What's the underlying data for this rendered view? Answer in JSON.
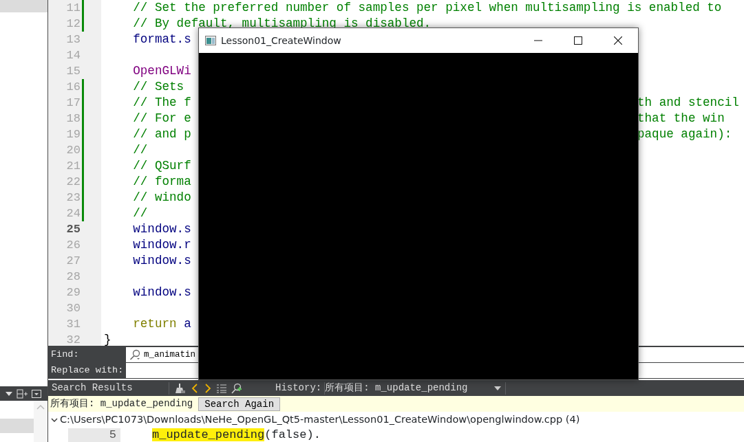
{
  "editor": {
    "lines": [
      {
        "number": "11",
        "modified": true,
        "current": false,
        "segments": [
          {
            "kind": "comment",
            "text": "    // Set the preferred number of samples per pixel when multisampling is enabled to"
          }
        ]
      },
      {
        "number": "12",
        "modified": true,
        "current": false,
        "segments": [
          {
            "kind": "comment",
            "text": "    // By default, multisampling is disabled."
          }
        ]
      },
      {
        "number": "13",
        "modified": false,
        "current": false,
        "segments": [
          {
            "kind": "code",
            "text": "    format.s"
          }
        ]
      },
      {
        "number": "14",
        "modified": false,
        "current": false
      },
      {
        "number": "15",
        "modified": false,
        "current": false,
        "segments": [
          {
            "kind": "type",
            "text": "    OpenGLWi"
          }
        ]
      },
      {
        "number": "16",
        "modified": true,
        "current": false,
        "segments": [
          {
            "kind": "comment",
            "text": "    // Sets"
          }
        ]
      },
      {
        "number": "17",
        "modified": true,
        "current": false,
        "segments": [
          {
            "kind": "comment",
            "text": "    // The f"
          }
        ],
        "after_window": {
          "kind": "comment",
          "text": "th and stencil"
        }
      },
      {
        "number": "18",
        "modified": true,
        "current": false,
        "segments": [
          {
            "kind": "comment",
            "text": "    // For e"
          }
        ],
        "after_window": {
          "kind": "comment",
          "text": "that the win"
        }
      },
      {
        "number": "19",
        "modified": true,
        "current": false,
        "segments": [
          {
            "kind": "comment",
            "text": "    // and p"
          }
        ],
        "after_window": {
          "kind": "comment",
          "text": "paque again):"
        }
      },
      {
        "number": "20",
        "modified": true,
        "current": false,
        "segments": [
          {
            "kind": "comment",
            "text": "    //"
          }
        ]
      },
      {
        "number": "21",
        "modified": true,
        "current": false,
        "segments": [
          {
            "kind": "comment",
            "text": "    // QSurf"
          }
        ]
      },
      {
        "number": "22",
        "modified": true,
        "current": false,
        "segments": [
          {
            "kind": "comment",
            "text": "    // forma"
          }
        ]
      },
      {
        "number": "23",
        "modified": true,
        "current": false,
        "segments": [
          {
            "kind": "comment",
            "text": "    // windo"
          }
        ]
      },
      {
        "number": "24",
        "modified": true,
        "current": false,
        "segments": [
          {
            "kind": "comment",
            "text": "    //"
          }
        ]
      },
      {
        "number": "25",
        "modified": false,
        "current": true,
        "segments": [
          {
            "kind": "code",
            "text": "    window.s"
          }
        ]
      },
      {
        "number": "26",
        "modified": false,
        "current": false,
        "segments": [
          {
            "kind": "code",
            "text": "    window.r"
          }
        ]
      },
      {
        "number": "27",
        "modified": false,
        "current": false,
        "segments": [
          {
            "kind": "code",
            "text": "    window.s"
          }
        ]
      },
      {
        "number": "28",
        "modified": false,
        "current": false
      },
      {
        "number": "29",
        "modified": false,
        "current": false,
        "segments": [
          {
            "kind": "code",
            "text": "    window.s"
          }
        ]
      },
      {
        "number": "30",
        "modified": false,
        "current": false
      },
      {
        "number": "31",
        "modified": false,
        "current": false,
        "segments": [
          {
            "kind": "keyword",
            "text": "    return"
          },
          {
            "kind": "code",
            "text": " a"
          }
        ]
      },
      {
        "number": "32",
        "modified": false,
        "current": false,
        "segments": [
          {
            "kind": "plain",
            "text": "}"
          }
        ]
      }
    ]
  },
  "find_bar": {
    "find_label": "Find:",
    "find_value": "m_animatin",
    "replace_label": "Replace with:"
  },
  "search_results": {
    "title": "Search Results",
    "history_label": "History:",
    "history_value": "所有项目: m_update_pending",
    "query": "所有项目: m_update_pending",
    "search_again": "Search Again",
    "files": [
      {
        "path": "C:\\Users\\PC1073\\Downloads\\NeHe_OpenGL_Qt5-master\\Lesson01_CreateWindow\\openglwindow.cpp (4)",
        "expanded": true,
        "matches": [
          {
            "line": "5",
            "match": "m_update_pending",
            "rest": "(false)."
          }
        ]
      }
    ]
  },
  "app_window": {
    "title": "Lesson01_CreateWindow"
  }
}
